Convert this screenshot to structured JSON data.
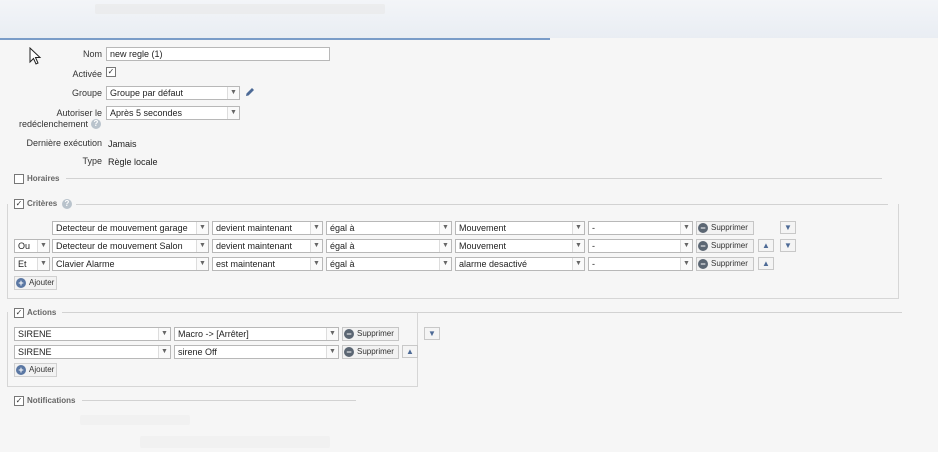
{
  "form": {
    "nom_label": "Nom",
    "nom_value": "new regle (1)",
    "activee_label": "Activée",
    "groupe_label": "Groupe",
    "groupe_value": "Groupe par défaut",
    "autoriser_label_1": "Autoriser le",
    "autoriser_label_2": "redéclenchement",
    "autoriser_value": "Après 5 secondes",
    "derniere_label": "Dernière exécution",
    "derniere_value": "Jamais",
    "type_label": "Type",
    "type_value": "Règle locale"
  },
  "sections": {
    "horaires": "Horaires",
    "criteres": "Critères",
    "actions": "Actions",
    "notifications": "Notifications"
  },
  "criteria": [
    {
      "op": "",
      "device": "Detecteur de mouvement garage",
      "cond": "devient maintenant",
      "cmp": "égal à",
      "value": "Mouvement",
      "extra": "-",
      "delete": "Supprimer",
      "up": false,
      "down": true
    },
    {
      "op": "Ou",
      "device": "Detecteur de mouvement Salon",
      "cond": "devient maintenant",
      "cmp": "égal à",
      "value": "Mouvement",
      "extra": "-",
      "delete": "Supprimer",
      "up": true,
      "down": true
    },
    {
      "op": "Et",
      "device": "Clavier Alarme",
      "cond": "est maintenant",
      "cmp": "égal à",
      "value": "alarme desactivé",
      "extra": "-",
      "delete": "Supprimer",
      "up": true,
      "down": false
    }
  ],
  "criteria_add": "Ajouter",
  "actions": [
    {
      "target": "SIRENE",
      "action": "Macro -> [Arrêter]",
      "delete": "Supprimer",
      "up": false,
      "down": true
    },
    {
      "target": "SIRENE",
      "action": "sirene Off",
      "delete": "Supprimer",
      "up": true,
      "down": false
    }
  ],
  "actions_add": "Ajouter",
  "icons": {
    "pencil": "pencil-icon",
    "help": "help-icon",
    "checkbox": "check-icon",
    "delete": "minus-circle-icon",
    "add": "plus-circle-icon",
    "arrow_up": "arrow-up-icon",
    "arrow_down": "arrow-down-icon"
  },
  "colors": {
    "accent": "#4d6a96",
    "border": "#b8b8b8",
    "background": "#f6f6f6"
  }
}
